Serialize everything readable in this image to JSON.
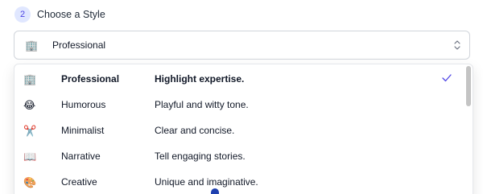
{
  "step": {
    "number": "2",
    "title": "Choose a Style"
  },
  "select": {
    "emoji": "🏢",
    "value": "Professional",
    "chevron_icon": "chevron-up-down-icon"
  },
  "options": [
    {
      "emoji": "🏢",
      "name": "Professional",
      "description": "Highlight expertise.",
      "selected": true
    },
    {
      "emoji": "😂",
      "name": "Humorous",
      "description": "Playful and witty tone.",
      "selected": false
    },
    {
      "emoji": "✂️",
      "name": "Minimalist",
      "description": "Clear and concise.",
      "selected": false
    },
    {
      "emoji": "📖",
      "name": "Narrative",
      "description": "Tell engaging stories.",
      "selected": false
    },
    {
      "emoji": "🎨",
      "name": "Creative",
      "description": "Unique and imaginative.",
      "selected": false
    }
  ],
  "colors": {
    "accent": "#4f46e5",
    "step_badge_bg": "#e0e7ff",
    "border": "#d1d5db"
  }
}
